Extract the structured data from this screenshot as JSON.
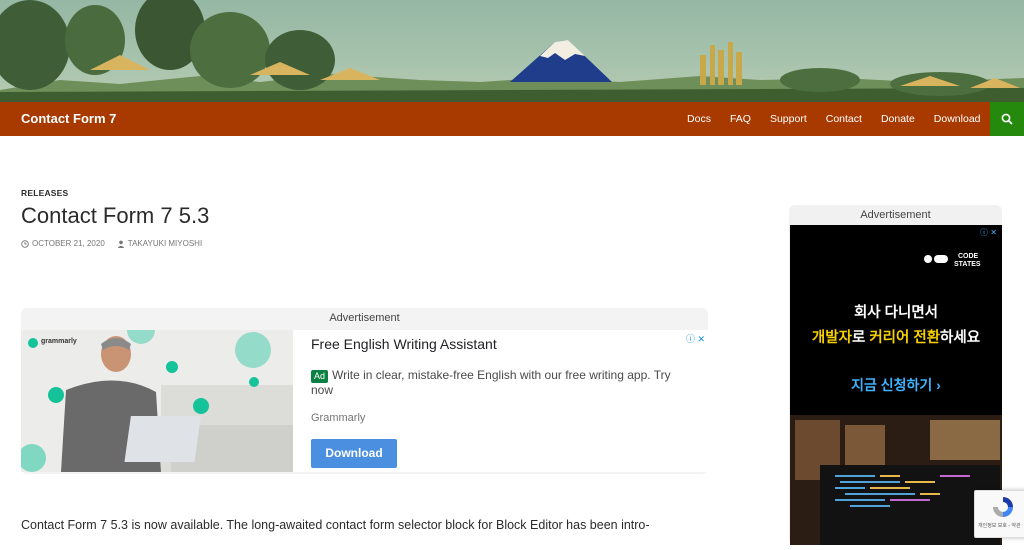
{
  "header": {
    "site_title": "Contact Form 7",
    "nav": [
      "Docs",
      "FAQ",
      "Support",
      "Contact",
      "Donate",
      "Download"
    ]
  },
  "post": {
    "category": "RELEASES",
    "title": "Contact Form 7 5.3",
    "date": "OCTOBER 21, 2020",
    "author": "TAKAYUKI MIYOSHI",
    "body_first_line": "Contact Form 7 5.3 is now available. The long-awaited contact form selector block for Block Editor has been intro-"
  },
  "inline_ad": {
    "label": "Advertisement",
    "brand": "grammarly",
    "headline": "Free English Writing Assistant",
    "badge": "Ad",
    "description": "Write in clear, mistake-free English with our free writing app. Try now",
    "advertiser": "Grammarly",
    "cta": "Download"
  },
  "sidebar_ad": {
    "label": "Advertisement",
    "logo_line1": "CODE",
    "logo_line2": "STATES",
    "line1": "회사 다니면서",
    "line2_highlight1": "개발자",
    "line2_mid": "로 ",
    "line2_highlight2": "커리어 전환",
    "line2_end": "하세요",
    "cta": "지금 신청하기 ›"
  },
  "recaptcha": {
    "text": "개인정보 보호 - 약관"
  },
  "colors": {
    "nav_bg": "#a83a00",
    "search_bg": "#24890d",
    "accent_blue": "#4a8fe0"
  }
}
